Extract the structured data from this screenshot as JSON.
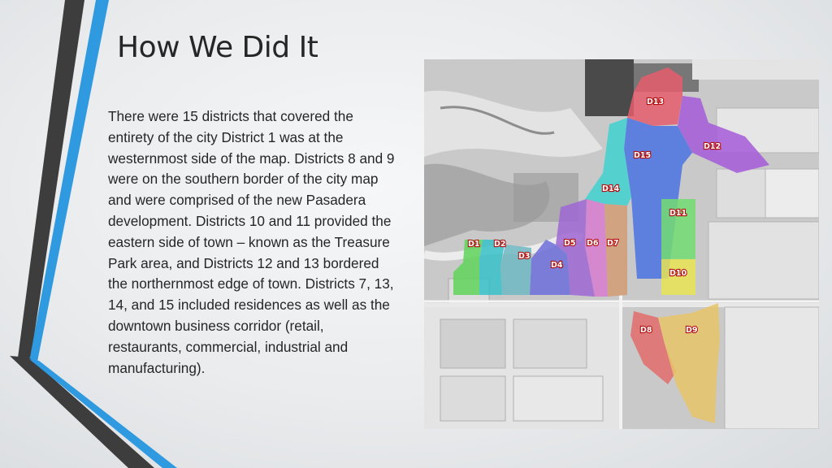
{
  "slide": {
    "title": "How We Did It",
    "body": "There were 15 districts that covered the entirety of the city District 1 was at the westernmost side of the map. Districts 8 and 9 were on the southern border of the city map and were comprised of the new Pasadera development.  Districts 10 and 11 provided the eastern side of town – known as the Treasure Park area, and Districts 12 and 13 bordered the northernmost edge of town.  Districts 7, 13, 14, and 15 included residences as well as the downtown business corridor (retail, restaurants, commercial, industrial and manufacturing)."
  },
  "colors": {
    "accent_blue": "#2f9ae0",
    "accent_dark": "#3d3d3d"
  },
  "map": {
    "districts": [
      {
        "id": "D1",
        "label": "D1",
        "color": "#5fd35a"
      },
      {
        "id": "D2",
        "label": "D2",
        "color": "#37c2c9"
      },
      {
        "id": "D3",
        "label": "D3",
        "color": "#6fb8c3"
      },
      {
        "id": "D4",
        "label": "D4",
        "color": "#6d6fd9"
      },
      {
        "id": "D5",
        "label": "D5",
        "color": "#9d66d2"
      },
      {
        "id": "D6",
        "label": "D6",
        "color": "#d77ccf"
      },
      {
        "id": "D7",
        "label": "D7",
        "color": "#d49c74"
      },
      {
        "id": "D8",
        "label": "D8",
        "color": "#e26c6c"
      },
      {
        "id": "D9",
        "label": "D9",
        "color": "#e7c46a"
      },
      {
        "id": "D10",
        "label": "D10",
        "color": "#e7e454"
      },
      {
        "id": "D11",
        "label": "D11",
        "color": "#72dc72"
      },
      {
        "id": "D12",
        "label": "D12",
        "color": "#a55ad8"
      },
      {
        "id": "D13",
        "label": "D13",
        "color": "#e55d6d"
      },
      {
        "id": "D14",
        "label": "D14",
        "color": "#40d2cf"
      },
      {
        "id": "D15",
        "label": "D15",
        "color": "#4a72e0"
      }
    ]
  }
}
